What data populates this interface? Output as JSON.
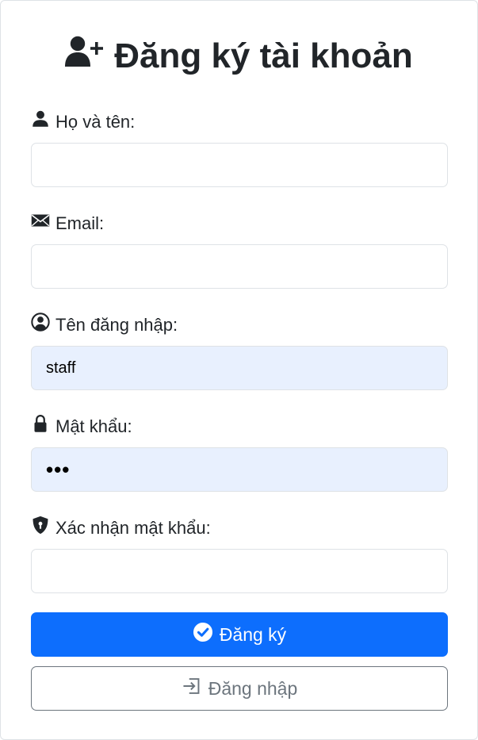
{
  "form": {
    "title": "Đăng ký tài khoản",
    "fields": [
      {
        "label": "Họ và tên:",
        "value": "",
        "icon": "person-icon"
      },
      {
        "label": "Email:",
        "value": "",
        "icon": "envelope-icon"
      },
      {
        "label": "Tên đăng nhập:",
        "value": "staff",
        "icon": "person-circle-icon"
      },
      {
        "label": "Mật khẩu:",
        "value": "•••",
        "icon": "lock-icon"
      },
      {
        "label": "Xác nhận mật khẩu:",
        "value": "",
        "icon": "shield-lock-icon"
      }
    ],
    "register_label": "Đăng ký",
    "login_label": "Đăng nhập"
  },
  "colors": {
    "primary": "#0d6efd",
    "secondary": "#6c757d",
    "autofill_bg": "#e8f0fe",
    "border": "#dee2e6"
  }
}
